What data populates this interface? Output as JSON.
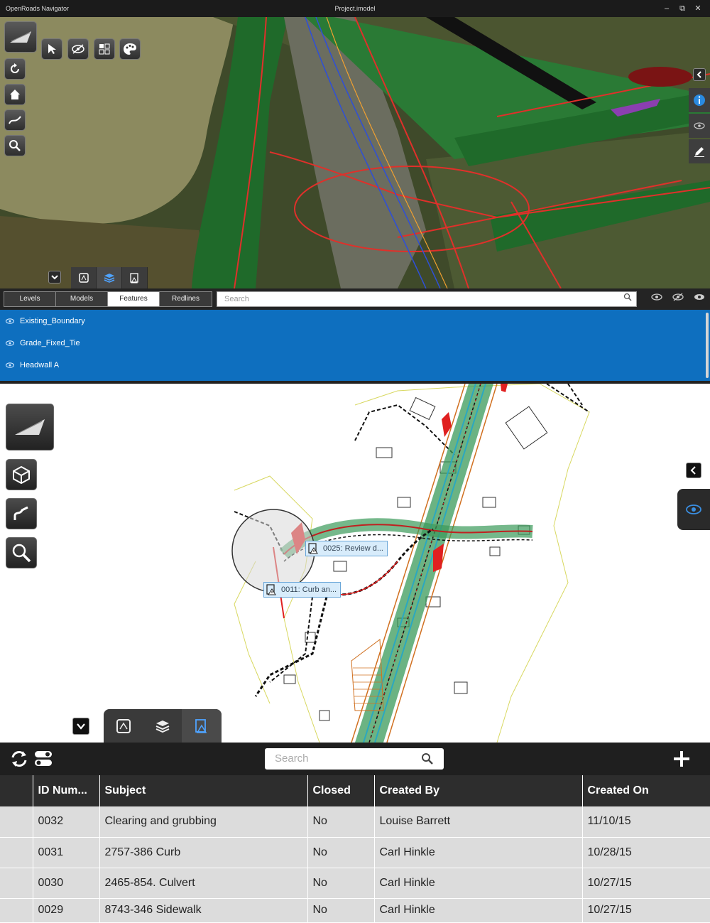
{
  "window": {
    "app_title": "OpenRoads Navigator",
    "document_title": "Project.imodel",
    "controls": [
      "–",
      "⧉",
      "✕"
    ]
  },
  "panel_tabs": {
    "items": [
      {
        "label": "Levels",
        "active": false
      },
      {
        "label": "Models",
        "active": false
      },
      {
        "label": "Features",
        "active": true
      },
      {
        "label": "Redlines",
        "active": false
      }
    ],
    "search_placeholder": "Search"
  },
  "features": {
    "items": [
      {
        "label": "Existing_Boundary"
      },
      {
        "label": "Grade_Fixed_Tie"
      },
      {
        "label": "Headwall A"
      }
    ]
  },
  "plan_view": {
    "callouts": [
      {
        "label": "0025: Review d..."
      },
      {
        "label": "0011: Curb an..."
      }
    ]
  },
  "issues": {
    "search_placeholder": "Search",
    "columns": [
      "ID Num...",
      "Subject",
      "Closed",
      "Created By",
      "Created On"
    ],
    "rows": [
      [
        "0032",
        "Clearing and grubbing",
        "No",
        "Louise Barrett",
        "11/10/15"
      ],
      [
        "0031",
        "2757-386 Curb",
        "No",
        "Carl Hinkle",
        "10/28/15"
      ],
      [
        "0030",
        "2465-854. Culvert",
        "No",
        "Carl Hinkle",
        "10/27/15"
      ],
      [
        "0029",
        "8743-346 Sidewalk",
        "No",
        "Carl Hinkle",
        "10/27/15"
      ]
    ]
  },
  "colors": {
    "selection_blue": "#0e6fbf",
    "toolbar_dark": "#242424",
    "row_grey": "#dcdcdc"
  }
}
